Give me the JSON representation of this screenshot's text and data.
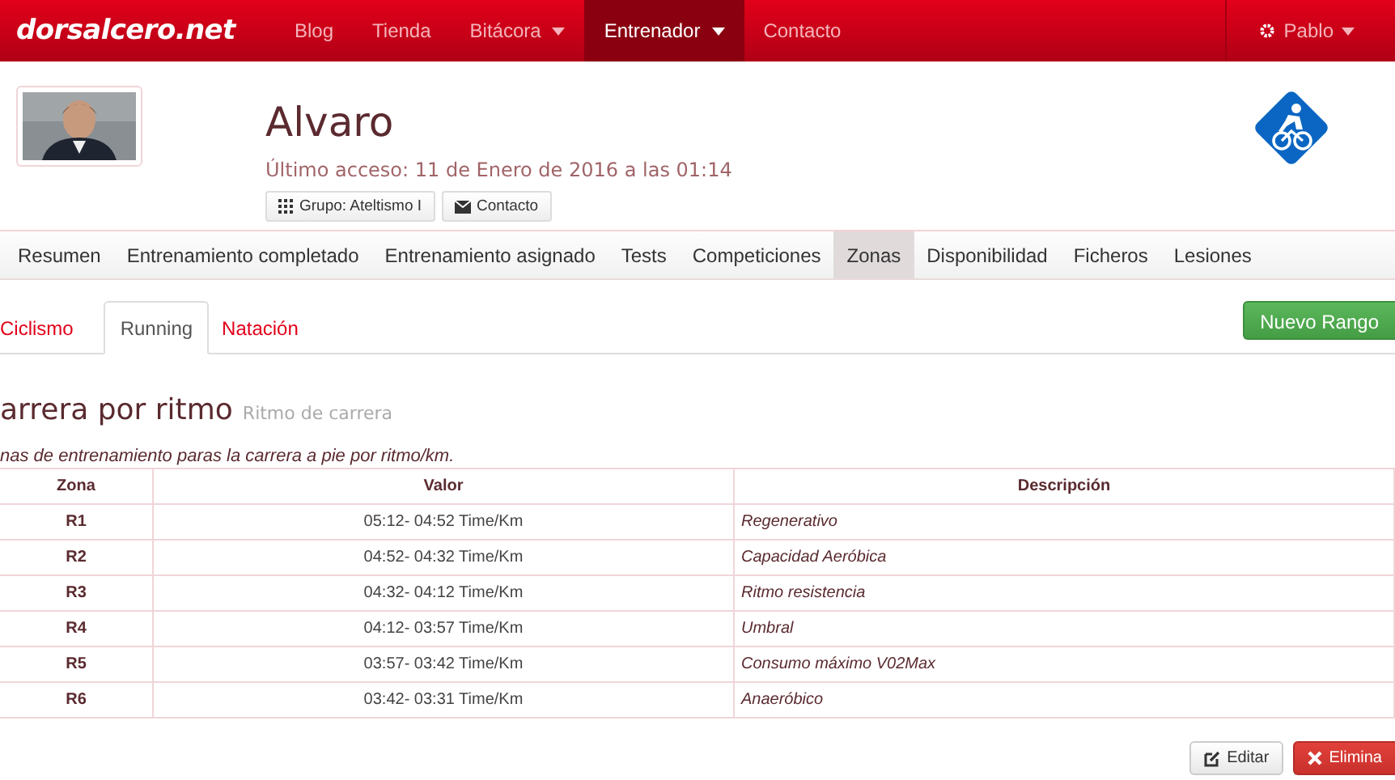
{
  "navbar": {
    "brand": "dorsalcero.net",
    "items": [
      {
        "label": "Blog",
        "selected": false,
        "dropdown": false
      },
      {
        "label": "Tienda",
        "selected": false,
        "dropdown": false
      },
      {
        "label": "Bitácora",
        "selected": false,
        "dropdown": true
      },
      {
        "label": "Entrenador",
        "selected": true,
        "dropdown": true
      },
      {
        "label": "Contacto",
        "selected": false,
        "dropdown": false
      }
    ],
    "user": "Pablo"
  },
  "profile": {
    "avatar": {
      "kind": "picture"
    },
    "name": "Alvaro",
    "last_access": "Último acceso: 11 de Enero de 2016 a las 01:14",
    "buttons": [
      "Grupo: Ateltismo I",
      "Contacto"
    ]
  },
  "sections": [
    {
      "label": "Resumen",
      "selected": false
    },
    {
      "label": "Entrenamiento completado",
      "selected": false
    },
    {
      "label": "Entrenamiento asignado",
      "selected": false
    },
    {
      "label": "Tests",
      "selected": false
    },
    {
      "label": "Competiciones",
      "selected": false
    },
    {
      "label": "Zonas",
      "selected": true
    },
    {
      "label": "Disponibilidad",
      "selected": false
    },
    {
      "label": "Ficheros",
      "selected": false
    },
    {
      "label": "Lesiones",
      "selected": false
    }
  ],
  "sport_tabs": [
    {
      "label": "Ciclismo",
      "selected": false
    },
    {
      "label": "Running",
      "selected": true
    },
    {
      "label": "Natación",
      "selected": false
    }
  ],
  "new_button": "Nuevo Rango",
  "heading": {
    "title": "arrera por ritmo",
    "subtitle": "Ritmo de carrera"
  },
  "description": "nas de entrenamiento paras la carrera a pie por ritmo/km.",
  "table": {
    "columns": [
      "Zona",
      "Valor",
      "Descripción"
    ],
    "rows": [
      [
        "R1",
        "05:12- 04:52  Time/Km",
        "Regenerativo"
      ],
      [
        "R2",
        "04:52- 04:32  Time/Km",
        "Capacidad Aeróbica"
      ],
      [
        "R3",
        "04:32- 04:12  Time/Km",
        "Ritmo resistencia"
      ],
      [
        "R4",
        "04:12- 03:57  Time/Km",
        "Umbral"
      ],
      [
        "R5",
        "03:57- 03:42  Time/Km",
        "Consumo máximo V02Max"
      ],
      [
        "R6",
        "03:42- 03:31  Time/Km",
        "Anaeróbico"
      ]
    ]
  },
  "actions": [
    "Editar",
    "Elimina"
  ]
}
